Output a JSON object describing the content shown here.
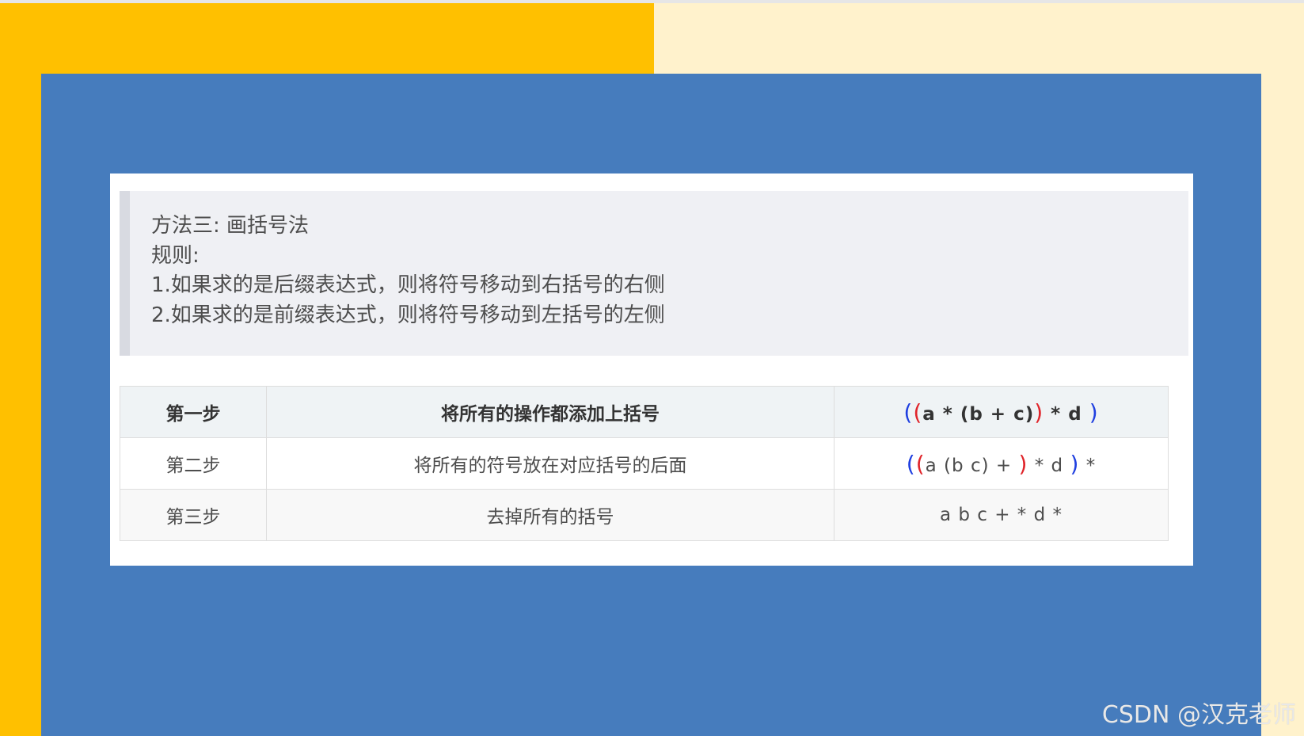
{
  "colors": {
    "left_background": "#ffc000",
    "right_background": "#fff2cc",
    "panel": "#467cbd",
    "paren_outer": "#1f3fe0",
    "paren_inner": "#e0242a"
  },
  "quote": {
    "title": "方法三: 画括号法",
    "rule_label": "规则:",
    "rule_1": "1.如果求的是后缀表达式，则将符号移动到右括号的右侧",
    "rule_2": "2.如果求的是前缀表达式，则将符号移动到左括号的左侧"
  },
  "table": {
    "rows": [
      {
        "step": "第一步",
        "action": "将所有的操作都添加上括号",
        "expr": {
          "outer_open": "(",
          "inner_open": "(",
          "body": "a * (b + c)",
          "inner_close": ")",
          "middle": " * d ",
          "outer_close": ")"
        }
      },
      {
        "step": "第二步",
        "action": "将所有的符号放在对应括号的后面",
        "expr": {
          "outer_open": "(",
          "inner_open": "(",
          "body": "a (b c) + ",
          "inner_close": ")",
          "middle": " * d ",
          "outer_close": ")",
          "tail": " *"
        }
      },
      {
        "step": "第三步",
        "action": "去掉所有的括号",
        "expr_text": "a b c + * d *"
      }
    ]
  },
  "watermark": "CSDN @汉克老师"
}
